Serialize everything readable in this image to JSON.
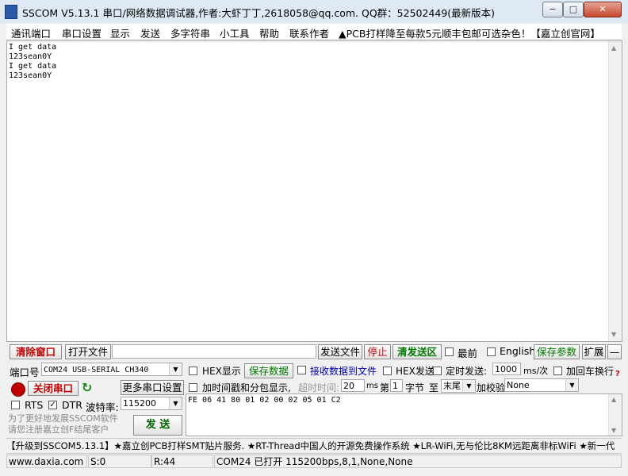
{
  "title_bar": {
    "title": "SSCOM V5.13.1 串口/网络数据调试器,作者:大虾丁丁,2618058@qq.com. QQ群：52502449(最新版本)",
    "minimize": "−",
    "maximize": "□",
    "close": "✕"
  },
  "menu": {
    "items": [
      "通讯端口",
      "串口设置",
      "显示",
      "发送",
      "多字符串",
      "小工具",
      "帮助",
      "联系作者"
    ],
    "ad": "▲PCB打样降至每款5元顺丰包邮可选杂色！【嘉立创官网】"
  },
  "receive": {
    "text": "I get data\n123sean0Y\nI get data\n123sean0Y"
  },
  "toolbar": {
    "clear_window": "清除窗口",
    "open_file": "打开文件",
    "file_path": "",
    "send_file": "发送文件",
    "stop": "停止",
    "clear_send": "清发送区",
    "topmost": "最前",
    "english": "English",
    "save_params": "保存参数",
    "expand": "扩展",
    "collapse": "—"
  },
  "port": {
    "label": "端口号",
    "value": "COM24 USB-SERIAL CH340",
    "close_port": "关闭串口",
    "more_settings": "更多串口设置",
    "rts": "RTS",
    "dtr": "DTR",
    "baud_label": "波特率:",
    "baud_value": "115200",
    "ad_text": "为了更好地发展SSCOM软件\n请您注册嘉立创F结尾客户",
    "send": "发 送"
  },
  "options": {
    "hex_display": "HEX显示",
    "save_data": "保存数据",
    "recv_to_file": "接收数据到文件",
    "hex_send": "HEX发送",
    "timed_send": "定时发送:",
    "timed_value": "1000",
    "timed_unit": "ms/次",
    "add_crlf": "加回车换行",
    "help": "?",
    "timestamp": "加时间戳和分包显示,",
    "timeout_label": "超时时间:",
    "timeout_value": "20",
    "timeout_unit": "ms",
    "byte_prefix": "第",
    "byte_value": "1",
    "byte_label": "字节",
    "to_label": "至",
    "end_value": "末尾",
    "checksum_label": "加校验",
    "checksum_value": "None"
  },
  "send_area": {
    "text": "FE 06 41 80 01 02 00 02 05 01 C2"
  },
  "ticker": {
    "text": "【升级到SSCOM5.13.1】★嘉立创PCB打样SMT贴片服务. ★RT-Thread中国人的开源免费操作系统 ★LR-WiFi,无与伦比8KM远距离非标WiFi ★新一代"
  },
  "status": {
    "website": "www.daxia.com",
    "sent": "S:0",
    "received": "R:44",
    "port_status": "COM24 已打开  115200bps,8,1,None,None"
  }
}
